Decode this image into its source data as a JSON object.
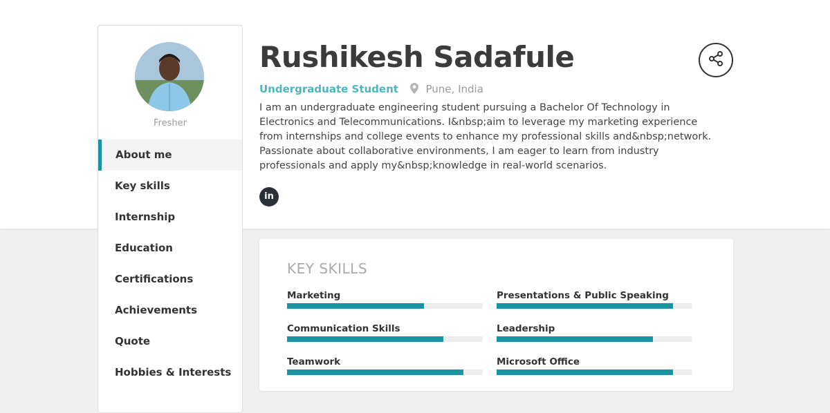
{
  "profile": {
    "name": "Rushikesh Sadafule",
    "role": "Undergraduate Student",
    "location": "Pune, India",
    "status": "Fresher",
    "bio": "I am an undergraduate engineering student pursuing a Bachelor Of Technology in Electronics and Telecommunications. I&nbsp;aim to leverage my marketing experience from internships and college events to enhance my professional skills and&nbsp;network. Passionate about collaborative environments, I am eager to learn from industry professionals and apply my&nbsp;knowledge in real-world scenarios."
  },
  "social": {
    "linkedin_label": "in"
  },
  "icons": {
    "share": "share-icon",
    "location": "map-pin-icon",
    "linkedin": "linkedin-icon"
  },
  "colors": {
    "accent": "#1a93a3",
    "role": "#4bb6c2",
    "text": "#333333"
  },
  "nav": [
    {
      "label": "About me",
      "active": true
    },
    {
      "label": "Key skills"
    },
    {
      "label": "Internship"
    },
    {
      "label": "Education"
    },
    {
      "label": "Certifications"
    },
    {
      "label": "Achievements"
    },
    {
      "label": "Quote"
    },
    {
      "label": "Hobbies & Interests"
    }
  ],
  "key_skills": {
    "title": "KEY SKILLS",
    "items": [
      {
        "name": "Marketing",
        "level": 0.7
      },
      {
        "name": "Presentations & Public Speaking",
        "level": 0.9
      },
      {
        "name": "Communication Skills",
        "level": 0.8
      },
      {
        "name": "Leadership",
        "level": 0.8
      },
      {
        "name": "Teamwork",
        "level": 0.9
      },
      {
        "name": "Microsoft Office",
        "level": 0.9
      }
    ]
  }
}
